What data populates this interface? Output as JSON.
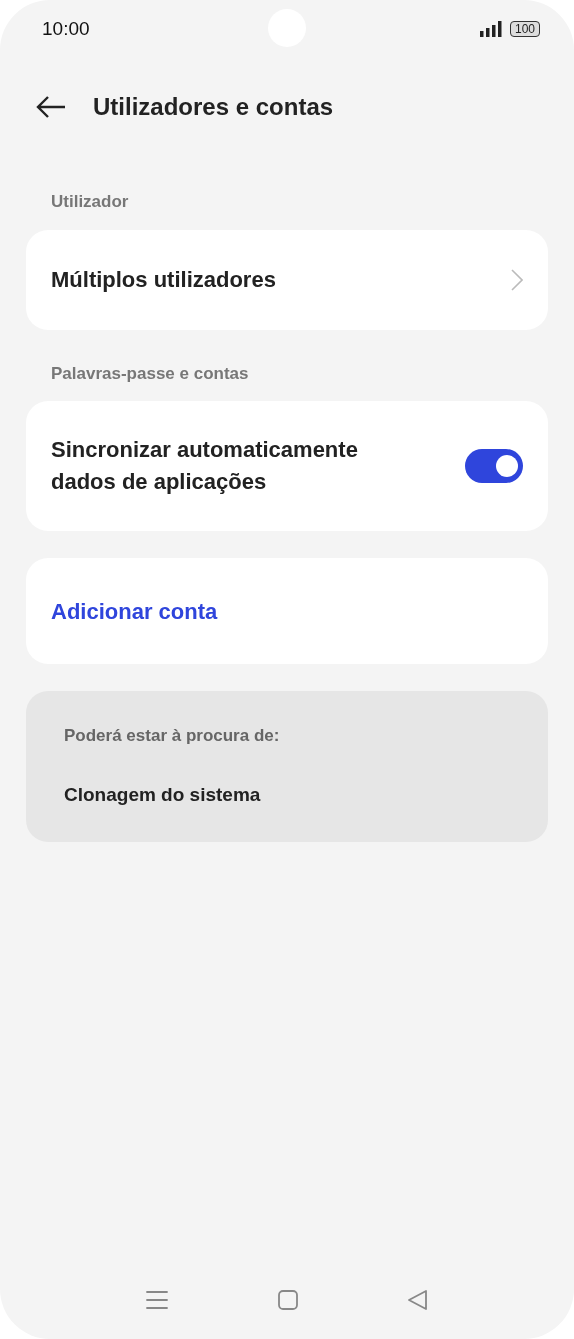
{
  "status_bar": {
    "time": "10:00",
    "battery": "100"
  },
  "header": {
    "title": "Utilizadores e contas"
  },
  "sections": [
    {
      "label": "Utilizador",
      "items": [
        {
          "kind": "link",
          "label": "Múltiplos utilizadores"
        }
      ]
    },
    {
      "label": "Palavras-passe e contas",
      "items": [
        {
          "kind": "toggle",
          "label": "Sincronizar automaticamente dados de aplicações",
          "on": true
        }
      ]
    }
  ],
  "action": {
    "label": "Adicionar conta"
  },
  "suggestions": {
    "title": "Poderá estar à procura de:",
    "items": [
      "Clonagem do sistema"
    ]
  }
}
